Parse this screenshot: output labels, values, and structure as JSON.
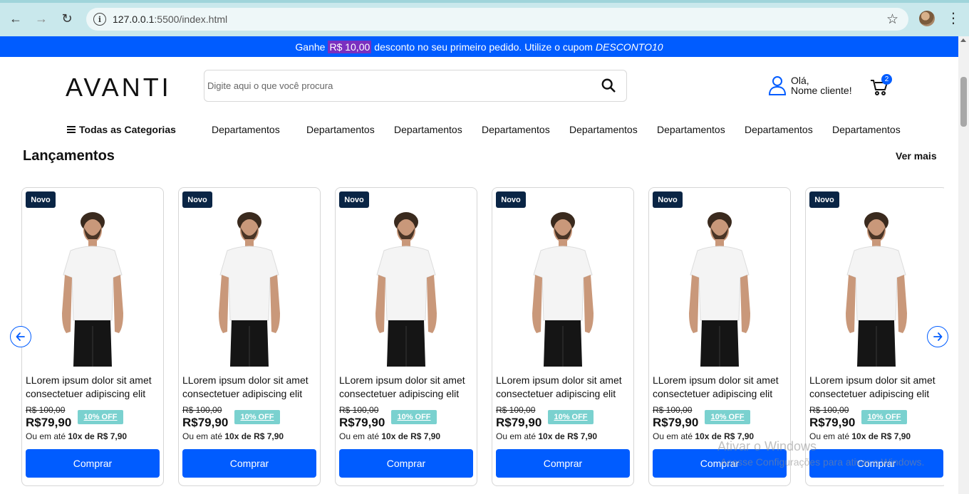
{
  "browser": {
    "url_host": "127.0.0.1",
    "url_rest": ":5500/index.html"
  },
  "promo": {
    "prefix": "Ganhe",
    "amount": "R$ 10,00",
    "middle": "desconto no seu primeiro pedido. Utilize o cupom",
    "code": "DESCONTO10"
  },
  "header": {
    "logo": "AVANTI",
    "search_placeholder": "Digite aqui o que você procura",
    "greeting_line1": "Olá,",
    "greeting_line2": "Nome cliente!",
    "cart_count": "2"
  },
  "nav": {
    "all_categories": "Todas as Categorias",
    "departments": [
      "Departamentos",
      "Departamentos",
      "Departamentos",
      "Departamentos",
      "Departamentos",
      "Departamentos",
      "Departamentos",
      "Departamentos"
    ]
  },
  "section": {
    "title": "Lançamentos",
    "see_more": "Ver mais"
  },
  "products": [
    {
      "tag": "Novo",
      "name": "LLorem ipsum dolor sit amet consectetuer adipiscing elit",
      "old_price": "R$ 100,00",
      "discount": "10% OFF",
      "price": "R$79,90",
      "installments_prefix": "Ou em até",
      "installments": "10x de R$ 7,90",
      "button": "Comprar"
    },
    {
      "tag": "Novo",
      "name": "LLorem ipsum dolor sit amet consectetuer adipiscing elit",
      "old_price": "R$ 100,00",
      "discount": "10% OFF",
      "price": "R$79,90",
      "installments_prefix": "Ou em até",
      "installments": "10x de R$ 7,90",
      "button": "Comprar"
    },
    {
      "tag": "Novo",
      "name": "LLorem ipsum dolor sit amet consectetuer adipiscing elit",
      "old_price": "R$ 100,00",
      "discount": "10% OFF",
      "price": "R$79,90",
      "installments_prefix": "Ou em até",
      "installments": "10x de R$ 7,90",
      "button": "Comprar"
    },
    {
      "tag": "Novo",
      "name": "LLorem ipsum dolor sit amet consectetuer adipiscing elit",
      "old_price": "R$ 100,00",
      "discount": "10% OFF",
      "price": "R$79,90",
      "installments_prefix": "Ou em até",
      "installments": "10x de R$ 7,90",
      "button": "Comprar"
    },
    {
      "tag": "Novo",
      "name": "LLorem ipsum dolor sit amet consectetuer adipiscing elit",
      "old_price": "R$ 100,00",
      "discount": "10% OFF",
      "price": "R$79,90",
      "installments_prefix": "Ou em até",
      "installments": "10x de R$ 7,90",
      "button": "Comprar"
    },
    {
      "tag": "Novo",
      "name": "LLorem ipsum dolor sit amet consectetuer adipiscing elit",
      "old_price": "R$ 100,00",
      "discount": "10% OFF",
      "price": "R$79,90",
      "installments_prefix": "Ou em até",
      "installments": "10x de R$ 7,90",
      "button": "Comprar"
    }
  ],
  "watermark": {
    "title": "Ativar o Windows",
    "subtitle": "Acesse Configurações para ativar o Windows."
  },
  "colors": {
    "brand_blue": "#005cff",
    "tag_navy": "#0a2545",
    "discount_teal": "#7ad1cf"
  }
}
